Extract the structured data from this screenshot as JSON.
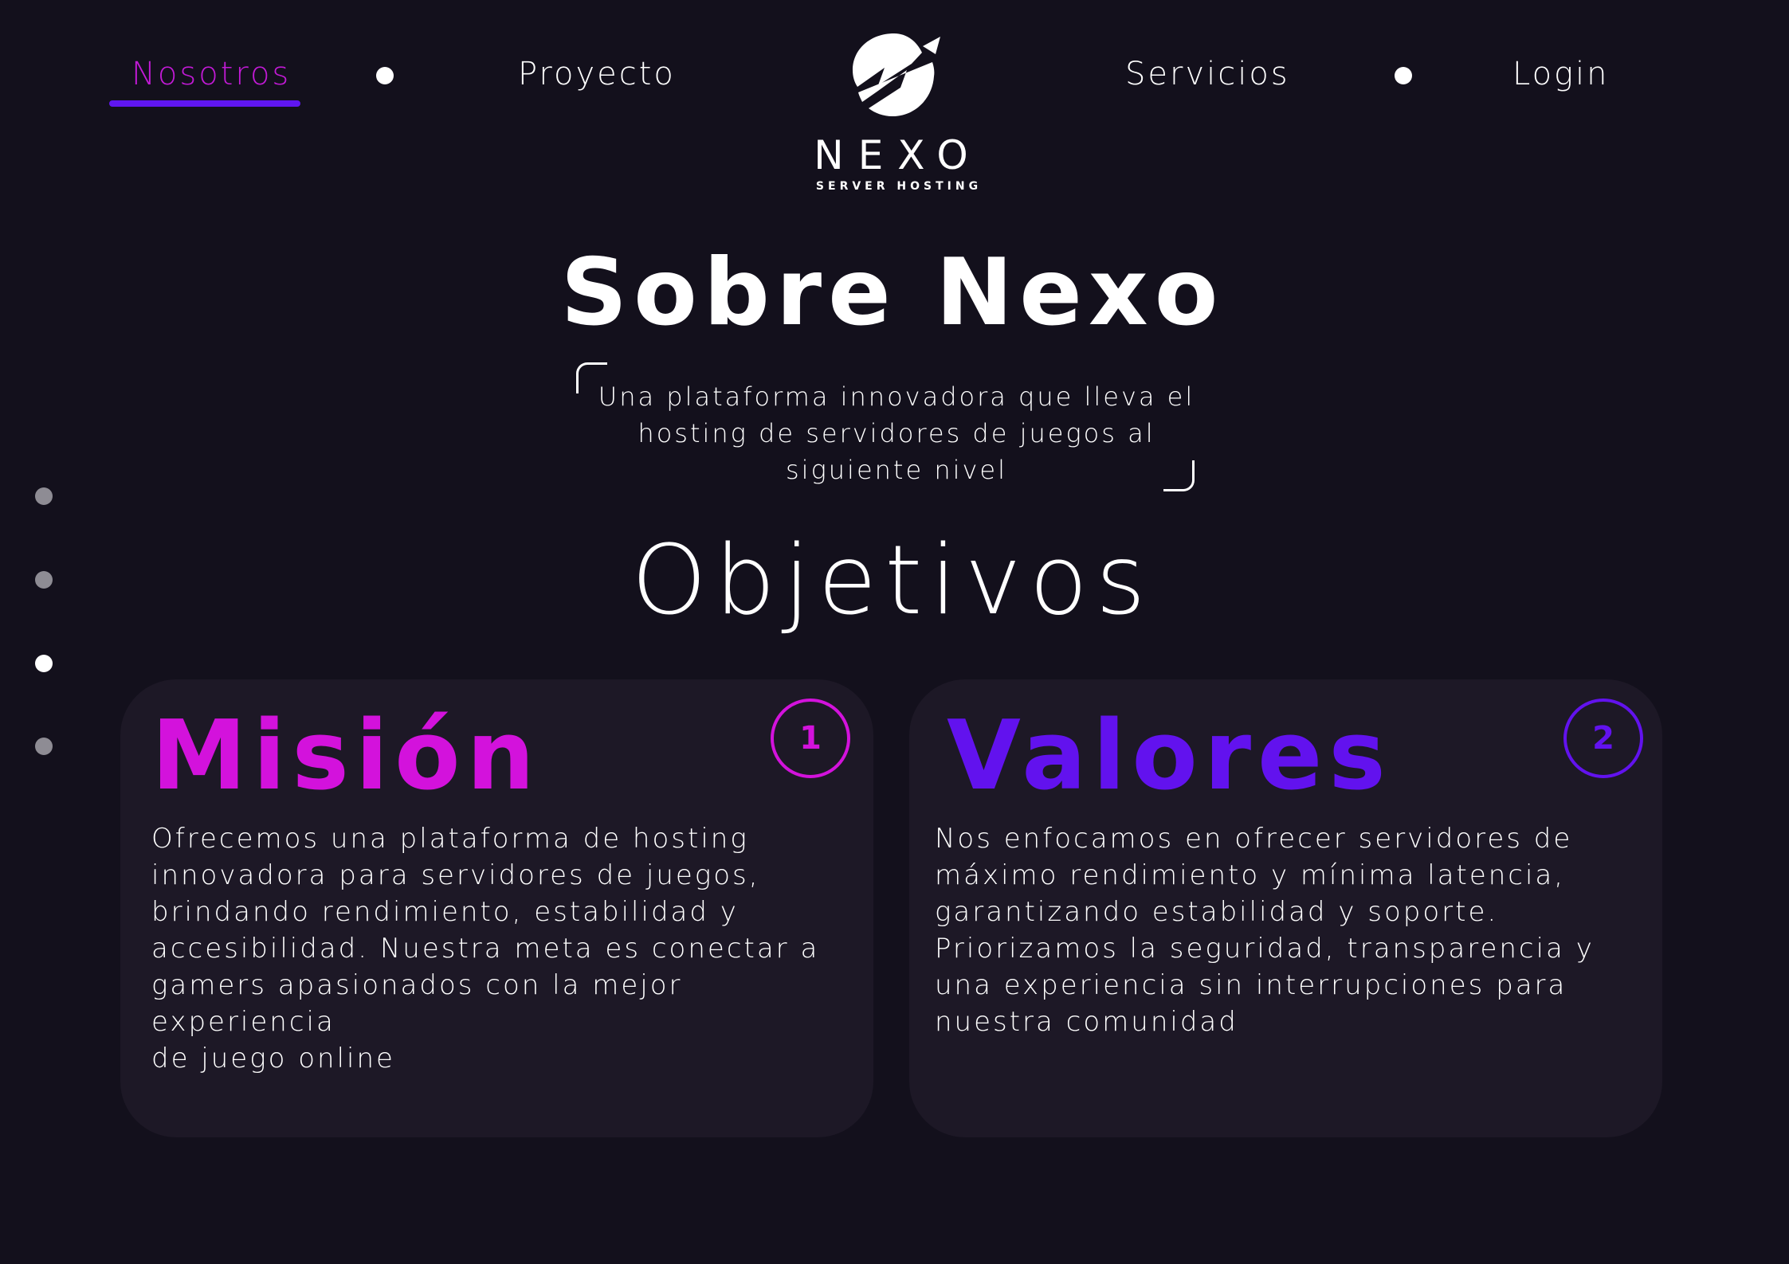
{
  "nav": {
    "left": [
      {
        "label": "Nosotros",
        "active": true
      },
      {
        "label": "Proyecto",
        "active": false
      }
    ],
    "right": [
      {
        "label": "Servicios",
        "active": false
      },
      {
        "label": "Login",
        "active": false
      }
    ]
  },
  "logo": {
    "icon": "lightning-bolt-icon",
    "wordmark": "NEXO",
    "subtitle": "SERVER HOSTING"
  },
  "hero": {
    "title": "Sobre Nexo",
    "tagline_lines": [
      "Una plataforma innovadora que lleva el",
      "hosting de servidores de juegos al",
      "siguiente nivel"
    ]
  },
  "section": {
    "title": "Objetivos"
  },
  "side_nav": {
    "count": 4,
    "active_index": 2
  },
  "cards": [
    {
      "number": "1",
      "title": "Misión",
      "color": "#d312dc",
      "lines": [
        "Ofrecemos una plataforma de hosting",
        "innovadora para servidores de juegos,",
        "brindando rendimiento, estabilidad y",
        "accesibilidad. Nuestra meta es conectar a",
        "gamers apasionados con la mejor experiencia",
        "de juego online"
      ]
    },
    {
      "number": "2",
      "title": "Valores",
      "color": "#6212ee",
      "lines": [
        "Nos enfocamos en ofrecer servidores de",
        "máximo rendimiento y mínima latencia,",
        "garantizando estabilidad y soporte.",
        "Priorizamos la seguridad, transparencia y",
        "una experiencia sin interrupciones para",
        "nuestra comunidad"
      ]
    }
  ],
  "colors": {
    "background": "#13101c",
    "card_background": "#1d1826",
    "accent_magenta": "#d312dc",
    "accent_violet": "#6212ee",
    "nav_active": "#c21ad6",
    "nav_underline": "#5f16f0"
  }
}
